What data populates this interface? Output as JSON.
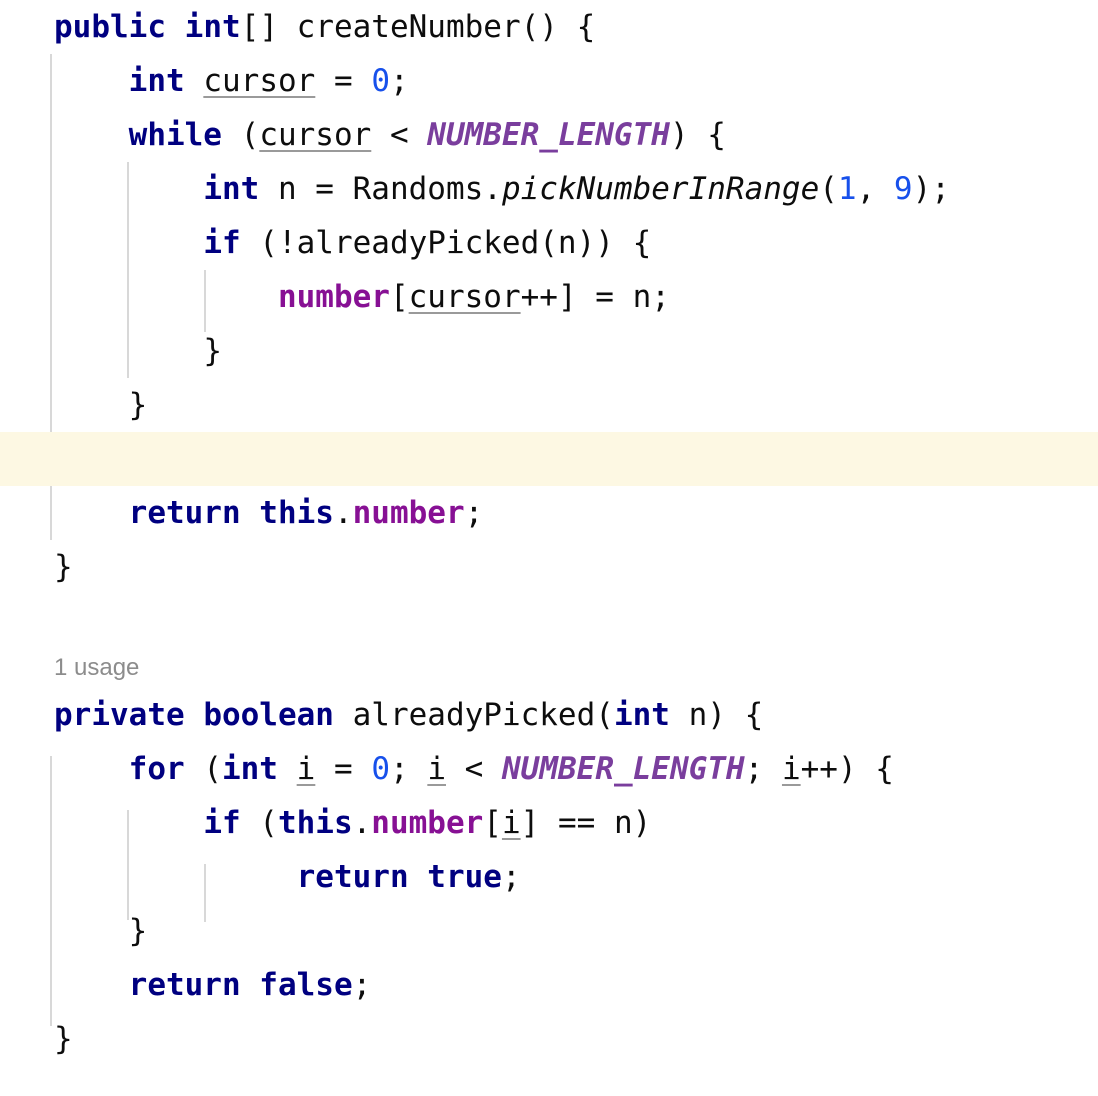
{
  "editor": {
    "language": "java",
    "background_color": "#ffffff",
    "caret_line_highlight_color": "#fdf8e3",
    "indent_guide_color": "#d8d8d8",
    "palette": {
      "keyword": "#000080",
      "number": "#1750eb",
      "static_final_field": "#7a3e9d",
      "instance_field": "#871094",
      "plain_text": "#0d0d0d",
      "inlay_hint": "#8c8c8c",
      "local_variable_underline": "#9a9a9a"
    },
    "inlay_hints": [
      {
        "id": "already-picked-usages",
        "text": "1 usage"
      }
    ],
    "lines": [
      {
        "n": 1,
        "indent": 0,
        "highlighted": false,
        "text": "public int[] createNumber() {"
      },
      {
        "n": 2,
        "indent": 1,
        "highlighted": false,
        "text": "int cursor = 0;"
      },
      {
        "n": 3,
        "indent": 1,
        "highlighted": false,
        "text": "while (cursor < NUMBER_LENGTH) {"
      },
      {
        "n": 4,
        "indent": 2,
        "highlighted": false,
        "text": "int n = Randoms.pickNumberInRange(1, 9);"
      },
      {
        "n": 5,
        "indent": 2,
        "highlighted": false,
        "text": "if (!alreadyPicked(n)) {"
      },
      {
        "n": 6,
        "indent": 3,
        "highlighted": false,
        "text": "number[cursor++] = n;"
      },
      {
        "n": 7,
        "indent": 2,
        "highlighted": false,
        "text": "}"
      },
      {
        "n": 8,
        "indent": 1,
        "highlighted": false,
        "text": "}"
      },
      {
        "n": 9,
        "indent": 0,
        "highlighted": true,
        "text": ""
      },
      {
        "n": 10,
        "indent": 1,
        "highlighted": false,
        "text": "return this.number;"
      },
      {
        "n": 11,
        "indent": 0,
        "highlighted": false,
        "text": "}"
      },
      {
        "n": 12,
        "indent": 0,
        "highlighted": false,
        "text": ""
      },
      {
        "n": 13,
        "indent": 0,
        "highlighted": false,
        "text": "private boolean alreadyPicked(int n) {"
      },
      {
        "n": 14,
        "indent": 1,
        "highlighted": false,
        "text": "for (int i = 0; i < NUMBER_LENGTH; i++) {"
      },
      {
        "n": 15,
        "indent": 2,
        "highlighted": false,
        "text": "if (this.number[i] == n)"
      },
      {
        "n": 16,
        "indent": 3,
        "highlighted": false,
        "text": "return true;"
      },
      {
        "n": 17,
        "indent": 1,
        "highlighted": false,
        "text": "}"
      },
      {
        "n": 18,
        "indent": 1,
        "highlighted": false,
        "text": "return false;"
      },
      {
        "n": 19,
        "indent": 0,
        "highlighted": false,
        "text": "}"
      }
    ],
    "tokens": {
      "l1": {
        "kw_public": "public",
        "kw_int": "int",
        "brackets": "[] ",
        "name": "createNumber",
        "tail": "() {"
      },
      "l2": {
        "kw_int": "int",
        "var_cursor": "cursor",
        "op": " = ",
        "num_zero": "0",
        "semi": ";"
      },
      "l3": {
        "kw_while": "while",
        "open": " (",
        "var_cursor": "cursor",
        "lt": " < ",
        "const_len": "NUMBER_LENGTH",
        "tail": ") {"
      },
      "l4": {
        "kw_int": "int",
        "name_n": " n = ",
        "cls": "Randoms.",
        "method": "pickNumberInRange",
        "p1": "(",
        "num_one": "1",
        "comma": ", ",
        "num_nine": "9",
        "tail": ");"
      },
      "l5": {
        "kw_if": "if",
        "rest": " (!alreadyPicked(n)) {"
      },
      "l6": {
        "field_number": "number",
        "lb": "[",
        "var_cursor": "cursor",
        "inc": "++",
        "rb": "] ",
        "assign": "= n;"
      },
      "l7": {
        "brace": "}"
      },
      "l8": {
        "brace": "}"
      },
      "l10": {
        "kw_return": "return",
        "kw_this": " this",
        "dot": ".",
        "field_number": "number",
        "semi": ";"
      },
      "l11": {
        "brace": "}"
      },
      "l13": {
        "kw_private": "private",
        "kw_boolean": " boolean",
        "name": " alreadyPicked(",
        "kw_int": "int",
        "tail": " n) {"
      },
      "l14": {
        "kw_for": "for",
        "open": " (",
        "kw_int": "int",
        "sp": " ",
        "var_i": "i",
        "eq": " = ",
        "num_zero": "0",
        "semi1": "; ",
        "var_i2": "i",
        "lt": " < ",
        "const_len": "NUMBER_LENGTH",
        "semi2": "; ",
        "var_i3": "i",
        "inc": "++",
        "tail": ") {"
      },
      "l15": {
        "kw_if": "if",
        "open": " (",
        "kw_this": "this",
        "dot": ".",
        "field_number": "number",
        "lb": "[",
        "var_i": "i",
        "rb": "] ",
        "tail": "== n)"
      },
      "l16": {
        "kw_return": "return",
        "kw_true": " true",
        "semi": ";"
      },
      "l17": {
        "brace": "}"
      },
      "l18": {
        "kw_return": "return",
        "kw_false": " false",
        "semi": ";"
      },
      "l19": {
        "brace": "}"
      }
    }
  }
}
